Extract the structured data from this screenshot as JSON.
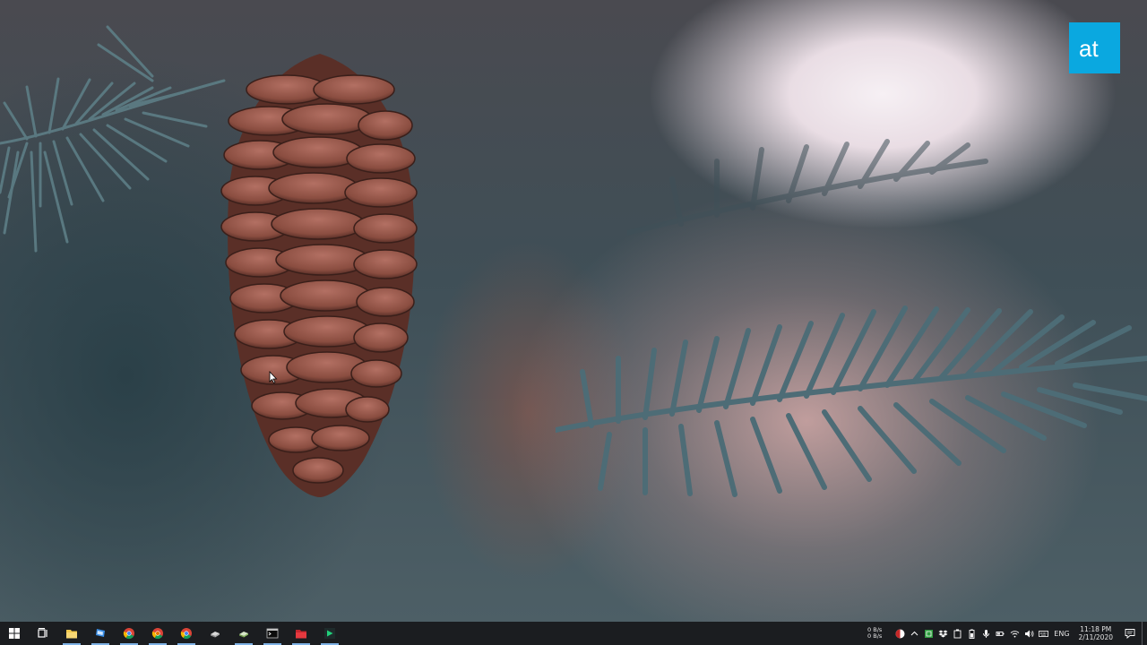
{
  "desktop": {
    "wallpaper_subject": "pine cone hanging from blue spruce branch",
    "logo_text": "at",
    "logo_color": "#0aa8e0"
  },
  "taskbar": {
    "background": "#1b1d20",
    "pinned": [
      {
        "id": "start",
        "icon": "windows-start-icon"
      },
      {
        "id": "task-view",
        "icon": "task-view-icon"
      },
      {
        "id": "file-explorer",
        "icon": "folder-icon"
      },
      {
        "id": "app-blue",
        "icon": "monitor-app-icon"
      },
      {
        "id": "chrome-1",
        "icon": "chrome-icon"
      },
      {
        "id": "chrome-2",
        "icon": "chrome-icon"
      },
      {
        "id": "chrome-3",
        "icon": "chrome-icon"
      },
      {
        "id": "app-drive",
        "icon": "drive-icon"
      },
      {
        "id": "app-drive-2",
        "icon": "drive-icon"
      },
      {
        "id": "terminal",
        "icon": "terminal-icon"
      },
      {
        "id": "app-red",
        "icon": "red-folder-icon"
      },
      {
        "id": "app-green",
        "icon": "green-play-icon"
      }
    ],
    "tray": {
      "upload_speed": "0 B/s",
      "download_speed": "0 B/s",
      "language": "ENG",
      "time": "11:18 PM",
      "date": "2/11/2020"
    }
  }
}
